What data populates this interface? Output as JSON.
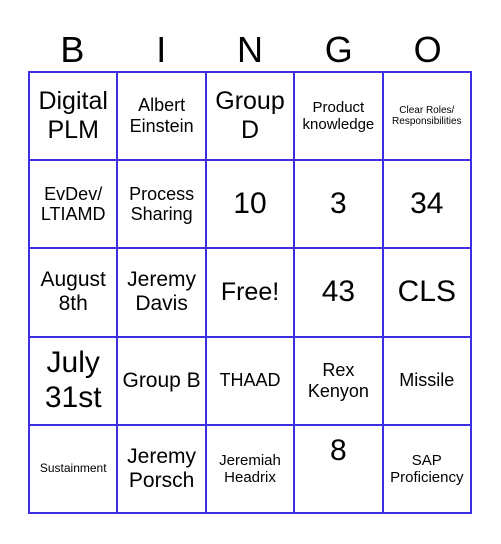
{
  "header": {
    "letters": [
      "B",
      "I",
      "N",
      "G",
      "O"
    ]
  },
  "accent_color": "#3d2ee6",
  "cells": [
    [
      "Digital PLM",
      "Albert Einstein",
      "Group D",
      "Product knowledge",
      "Clear Roles/ Responsibilities"
    ],
    [
      "EvDev/ LTIAMD",
      "Process Sharing",
      "10",
      "3",
      "34"
    ],
    [
      "August 8th",
      "Jeremy Davis",
      "Free!",
      "43",
      "CLS"
    ],
    [
      "July 31st",
      "Group B",
      "THAAD",
      "Rex Kenyon",
      "Missile"
    ],
    [
      "Sustainment",
      "Jeremy Porsch",
      "Jeremiah Headrix",
      "8",
      "SAP Proficiency"
    ]
  ]
}
